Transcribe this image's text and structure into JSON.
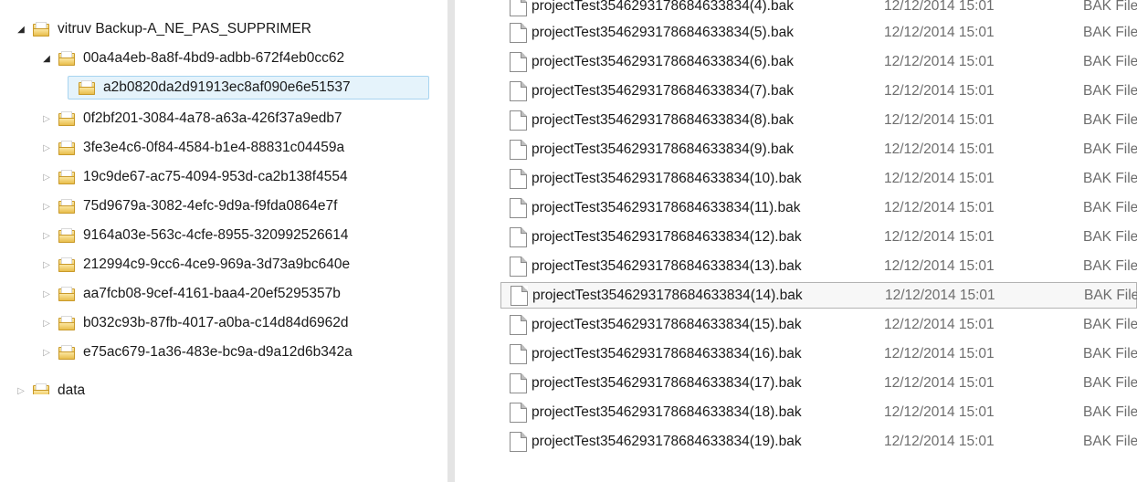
{
  "tree": {
    "root": {
      "label": "vitruv Backup-A_NE_PAS_SUPPRIMER",
      "expanded": true
    },
    "parent": {
      "label": "00a4a4eb-8a8f-4bd9-adbb-672f4eb0cc62",
      "expanded": true
    },
    "selected_child": {
      "label": "a2b0820da2d91913ec8af090e6e51537"
    },
    "siblings": [
      "0f2bf201-3084-4a78-a63a-426f37a9edb7",
      "3fe3e4c6-0f84-4584-b1e4-88831c04459a",
      "19c9de67-ac75-4094-953d-ca2b138f4554",
      "75d9679a-3082-4efc-9d9a-f9fda0864e7f",
      "9164a03e-563c-4cfe-8955-320992526614",
      "212994c9-9cc6-4ce9-969a-3d73a9bc640e",
      "aa7fcb08-9cef-4161-baa4-20ef5295357b",
      "b032c93b-87fb-4017-a0ba-c14d84d6962d",
      "e75ac679-1a36-483e-bc9a-d9a12d6b342a"
    ],
    "partial_item": "data"
  },
  "files": {
    "items": [
      {
        "name": "projectTest3546293178684633834(4).bak",
        "date": "12/12/2014 15:01",
        "type": "BAK File"
      },
      {
        "name": "projectTest3546293178684633834(5).bak",
        "date": "12/12/2014 15:01",
        "type": "BAK File"
      },
      {
        "name": "projectTest3546293178684633834(6).bak",
        "date": "12/12/2014 15:01",
        "type": "BAK File"
      },
      {
        "name": "projectTest3546293178684633834(7).bak",
        "date": "12/12/2014 15:01",
        "type": "BAK File"
      },
      {
        "name": "projectTest3546293178684633834(8).bak",
        "date": "12/12/2014 15:01",
        "type": "BAK File"
      },
      {
        "name": "projectTest3546293178684633834(9).bak",
        "date": "12/12/2014 15:01",
        "type": "BAK File"
      },
      {
        "name": "projectTest3546293178684633834(10).bak",
        "date": "12/12/2014 15:01",
        "type": "BAK File"
      },
      {
        "name": "projectTest3546293178684633834(11).bak",
        "date": "12/12/2014 15:01",
        "type": "BAK File"
      },
      {
        "name": "projectTest3546293178684633834(12).bak",
        "date": "12/12/2014 15:01",
        "type": "BAK File"
      },
      {
        "name": "projectTest3546293178684633834(13).bak",
        "date": "12/12/2014 15:01",
        "type": "BAK File"
      },
      {
        "name": "projectTest3546293178684633834(14).bak",
        "date": "12/12/2014 15:01",
        "type": "BAK File",
        "selected": true
      },
      {
        "name": "projectTest3546293178684633834(15).bak",
        "date": "12/12/2014 15:01",
        "type": "BAK File"
      },
      {
        "name": "projectTest3546293178684633834(16).bak",
        "date": "12/12/2014 15:01",
        "type": "BAK File"
      },
      {
        "name": "projectTest3546293178684633834(17).bak",
        "date": "12/12/2014 15:01",
        "type": "BAK File"
      },
      {
        "name": "projectTest3546293178684633834(18).bak",
        "date": "12/12/2014 15:01",
        "type": "BAK File"
      },
      {
        "name": "projectTest3546293178684633834(19).bak",
        "date": "12/12/2014 15:01",
        "type": "BAK File"
      }
    ]
  },
  "icons": {
    "expanded": "triangle-expanded-icon",
    "collapsed": "triangle-collapsed-icon",
    "folder": "folder-icon",
    "file": "file-icon"
  },
  "colors": {
    "selection_bg": "#e5f3fb",
    "selection_border": "#a8d4f0",
    "secondary_text": "#6d6d6d"
  }
}
